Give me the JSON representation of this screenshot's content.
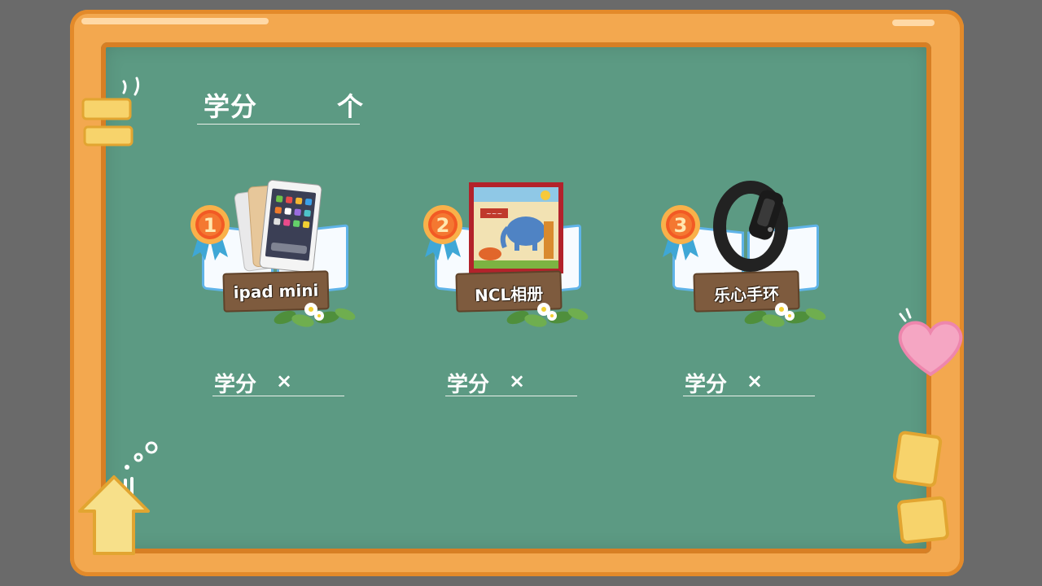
{
  "header": {
    "title": "学分",
    "unit": "个"
  },
  "prizes": [
    {
      "rank": "1",
      "name": "ipad  mini",
      "credit_label": "学分",
      "multiply": "×"
    },
    {
      "rank": "2",
      "name": "NCL相册",
      "credit_label": "学分",
      "multiply": "×"
    },
    {
      "rank": "3",
      "name": "乐心手环",
      "credit_label": "学分",
      "multiply": "×"
    }
  ],
  "colors": {
    "board": "#5c9a83",
    "frame": "#f3a84f",
    "frame_edge": "#d77f24",
    "medal": "#f47a32",
    "ribbon": "#3fa7d6",
    "plank": "#7e5b3e",
    "heart": "#f5a6c3",
    "sticky_note": "#f7d36b"
  },
  "icons": [
    "medal-icon",
    "heart-icon",
    "home-icon",
    "sticky-note-icon",
    "book-icon",
    "flower-leaves-icon"
  ]
}
